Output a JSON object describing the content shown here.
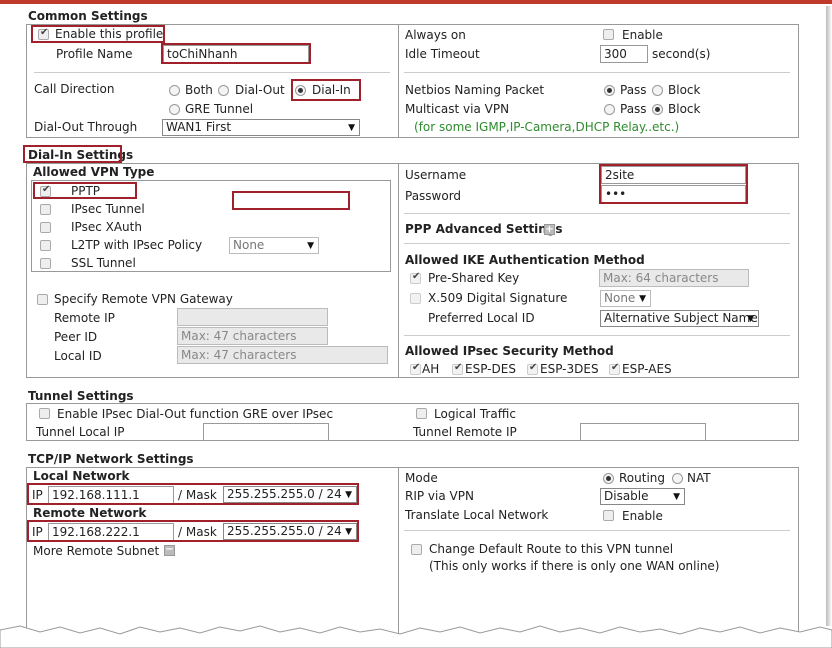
{
  "common": {
    "title": "Common Settings",
    "enable_profile_label": "Enable this profile",
    "profile_name_label": "Profile Name",
    "profile_name_value": "toChiNhanh",
    "call_direction_label": "Call Direction",
    "opt_both": "Both",
    "opt_dialout": "Dial-Out",
    "opt_dialin": "Dial-In",
    "opt_gre": "GRE Tunnel",
    "dialout_through_label": "Dial-Out Through",
    "dialout_through_value": "WAN1 First",
    "always_on_label": "Always on",
    "always_on_enable": "Enable",
    "idle_timeout_label": "Idle Timeout",
    "idle_timeout_value": "300",
    "idle_timeout_unit": "second(s)",
    "netbios_label": "Netbios Naming Packet",
    "multicast_label": "Multicast via VPN",
    "pass": "Pass",
    "block": "Block",
    "multicast_note": "(for some IGMP,IP-Camera,DHCP Relay..etc.)"
  },
  "dialin": {
    "title": "Dial-In Settings",
    "allowed_vpn_type": "Allowed VPN Type",
    "pptp": "PPTP",
    "ipsec_tunnel": "IPsec Tunnel",
    "ipsec_xauth": "IPsec XAuth",
    "l2tp": "L2TP with IPsec Policy",
    "l2tp_policy": "None",
    "ssl_tunnel": "SSL Tunnel",
    "specify_gateway": "Specify Remote VPN Gateway",
    "remote_ip": "Remote IP",
    "peer_id": "Peer ID",
    "local_id": "Local ID",
    "max47": "Max: 47 characters",
    "username_label": "Username",
    "username_value": "2site",
    "password_label": "Password",
    "password_value": "•••",
    "ppp_adv": "PPP Advanced Settings",
    "ike_title": "Allowed IKE Authentication Method",
    "psk": "Pre-Shared Key",
    "psk_placeholder": "Max: 64 characters",
    "x509": "X.509 Digital Signature",
    "x509_value": "None",
    "pref_local_id": "Preferred Local ID",
    "pref_local_id_value": "Alternative Subject Name",
    "sec_title": "Allowed IPsec Security Method",
    "ah": "AH",
    "esp_des": "ESP-DES",
    "esp_3des": "ESP-3DES",
    "esp_aes": "ESP-AES"
  },
  "tunnel": {
    "title": "Tunnel Settings",
    "enable_gre": "Enable IPsec Dial-Out function GRE over IPsec",
    "logical_traffic": "Logical Traffic",
    "local_ip": "Tunnel Local IP",
    "remote_ip": "Tunnel Remote IP"
  },
  "tcpip": {
    "title": "TCP/IP Network Settings",
    "local_network": "Local Network",
    "remote_network": "Remote Network",
    "ip": "IP",
    "mask": "/ Mask",
    "local_ip": "192.168.111.1",
    "local_mask": "255.255.255.0 / 24",
    "remote_ip": "192.168.222.1",
    "remote_mask": "255.255.255.0 / 24",
    "more_subnet": "More Remote Subnet",
    "mode_label": "Mode",
    "routing": "Routing",
    "nat": "NAT",
    "rip_label": "RIP via VPN",
    "rip_value": "Disable",
    "translate_label": "Translate Local Network",
    "translate_enable": "Enable",
    "change_route": "Change Default Route to this VPN tunnel",
    "change_route_note": "(This only works if there is only one WAN online)"
  }
}
